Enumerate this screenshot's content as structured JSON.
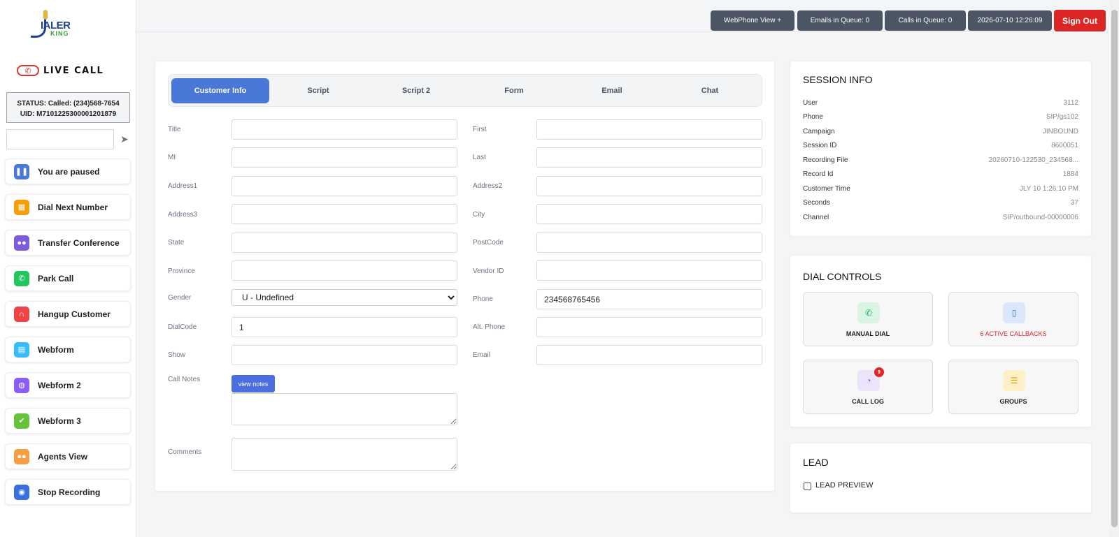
{
  "brand": {
    "logo_main": "IALER",
    "logo_sub": "KING",
    "live_call": "LIVE CALL"
  },
  "status": {
    "line1": "STATUS: Called: (234)568-7654",
    "line2": "UID: M7101225300001201879"
  },
  "search": {
    "value": ""
  },
  "sidebar": {
    "items": [
      {
        "label": "You are paused",
        "icon": "pause-icon",
        "color": "#4a78d9"
      },
      {
        "label": "Dial Next Number",
        "icon": "grid-icon",
        "color": "#f59e0b"
      },
      {
        "label": "Transfer Conference",
        "icon": "users-icon",
        "color": "#7c5cdb"
      },
      {
        "label": "Park Call",
        "icon": "phone-icon",
        "color": "#22c55e"
      },
      {
        "label": "Hangup Customer",
        "icon": "headset-icon",
        "color": "#ef4444"
      },
      {
        "label": "Webform",
        "icon": "file-icon",
        "color": "#38bdf8"
      },
      {
        "label": "Webform 2",
        "icon": "globe-icon",
        "color": "#8b5cf6"
      },
      {
        "label": "Webform 3",
        "icon": "check-square-icon",
        "color": "#65c23a"
      },
      {
        "label": "Agents View",
        "icon": "users-icon",
        "color": "#f59e42"
      },
      {
        "label": "Stop Recording",
        "icon": "record-icon",
        "color": "#3b6fd9"
      }
    ]
  },
  "topbar": {
    "webphone": "WebPhone View +",
    "emails": "Emails in Queue: 0",
    "calls": "Calls in Queue: 0",
    "datetime": "2026-07-10 12:26:09",
    "signout": "Sign Out"
  },
  "tabs": [
    "Customer Info",
    "Script",
    "Script 2",
    "Form",
    "Email",
    "Chat"
  ],
  "form": {
    "title": {
      "label": "Title",
      "value": ""
    },
    "first": {
      "label": "First",
      "value": ""
    },
    "mi": {
      "label": "MI",
      "value": ""
    },
    "last": {
      "label": "Last",
      "value": ""
    },
    "address1": {
      "label": "Address1",
      "value": ""
    },
    "address2": {
      "label": "Address2",
      "value": ""
    },
    "address3": {
      "label": "Address3",
      "value": ""
    },
    "city": {
      "label": "City",
      "value": ""
    },
    "state": {
      "label": "State",
      "value": ""
    },
    "postcode": {
      "label": "PostCode",
      "value": ""
    },
    "province": {
      "label": "Province",
      "value": ""
    },
    "vendor_id": {
      "label": "Vendor ID",
      "value": ""
    },
    "gender": {
      "label": "Gender",
      "value": "U - Undefined"
    },
    "phone": {
      "label": "Phone",
      "value": "234568765456"
    },
    "dialcode": {
      "label": "DialCode",
      "value": "1"
    },
    "alt_phone": {
      "label": "Alt. Phone",
      "value": ""
    },
    "show": {
      "label": "Show",
      "value": ""
    },
    "email": {
      "label": "Email",
      "value": ""
    },
    "call_notes": {
      "label": "Call Notes",
      "button": "view notes"
    },
    "comments": {
      "label": "Comments"
    }
  },
  "session_info": {
    "title": "SESSION INFO",
    "rows": [
      {
        "key": "User",
        "value": "3112"
      },
      {
        "key": "Phone",
        "value": "SIP/gs102"
      },
      {
        "key": "Campaign",
        "value": "JINBOUND"
      },
      {
        "key": "Session ID",
        "value": "8600051"
      },
      {
        "key": "Recording File",
        "value": "20260710-122530_234568..."
      },
      {
        "key": "Record Id",
        "value": "1884"
      },
      {
        "key": "Customer Time",
        "value": "JLY 10 1:26:10 PM"
      },
      {
        "key": "Seconds",
        "value": "37"
      },
      {
        "key": "Channel",
        "value": "SIP/outbound-00000006"
      }
    ]
  },
  "dial_controls": {
    "title": "DIAL CONTROLS",
    "manual_dial": "MANUAL DIAL",
    "callbacks": "6 ACTIVE CALLBACKS",
    "call_log": "CALL LOG",
    "call_log_badge": "9",
    "groups": "GROUPS"
  },
  "lead": {
    "title": "LEAD",
    "preview_label": "LEAD PREVIEW"
  },
  "colors": {
    "accent": "#4a78d9",
    "danger": "#dc2626",
    "callbacks": "#dc2626"
  }
}
